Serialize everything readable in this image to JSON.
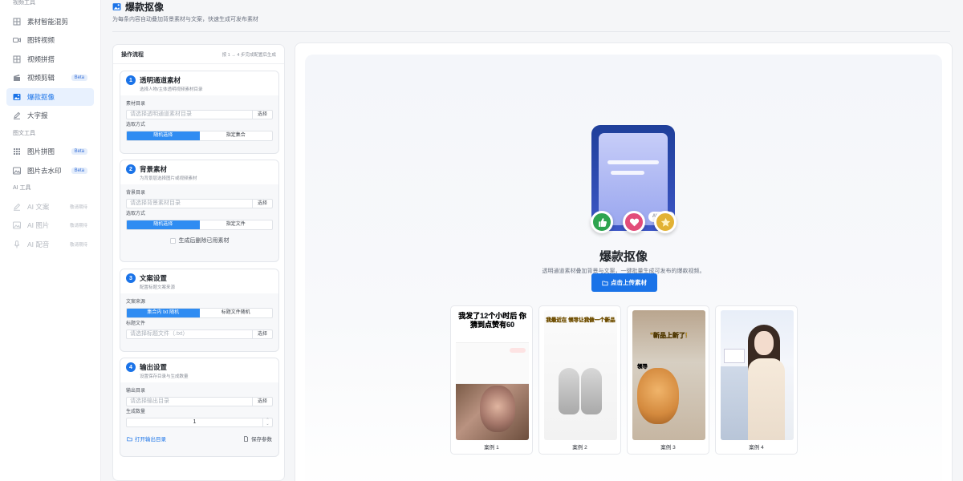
{
  "sidebar": {
    "sections": [
      {
        "title": "视频工具",
        "items": [
          {
            "label": "素材智能混剪",
            "icon": "grid-icon",
            "badge": "",
            "note": ""
          },
          {
            "label": "图转视频",
            "icon": "video-camera-icon",
            "badge": "",
            "note": ""
          },
          {
            "label": "视频拼搭",
            "icon": "grid-icon",
            "badge": "",
            "note": ""
          },
          {
            "label": "视频剪辑",
            "icon": "clapper-icon",
            "badge": "Beta",
            "note": ""
          },
          {
            "label": "爆款抠像",
            "icon": "image-icon",
            "badge": "",
            "note": "",
            "active": true
          },
          {
            "label": "大字报",
            "icon": "pen-icon",
            "badge": "",
            "note": ""
          }
        ]
      },
      {
        "title": "图文工具",
        "items": [
          {
            "label": "图片拼图",
            "icon": "grid-icon",
            "badge": "Beta",
            "note": ""
          },
          {
            "label": "图片去水印",
            "icon": "image-icon",
            "badge": "Beta",
            "note": ""
          }
        ]
      },
      {
        "title": "AI 工具",
        "items": [
          {
            "label": "AI 文案",
            "icon": "pen-icon",
            "badge": "",
            "note": "敬请期待"
          },
          {
            "label": "AI 图片",
            "icon": "image-icon",
            "badge": "",
            "note": "敬请期待"
          },
          {
            "label": "AI 配音",
            "icon": "microphone-icon",
            "badge": "",
            "note": "敬请期待"
          }
        ]
      }
    ]
  },
  "header": {
    "title": "爆款抠像",
    "subtitle": "为每条内容自动叠加背景素材与文案，快速生成可发布素材"
  },
  "flow": {
    "title": "操作流程",
    "hint": "按 1 → 4 步完成配置后生成",
    "step1": {
      "num": "1",
      "title": "透明通道素材",
      "desc": "选择人物/主体透明视频素材目录",
      "dir_label": "素材目录",
      "dir_placeholder": "请选择透明通道素材目录",
      "pick": "选择",
      "mode_label": "选取方式",
      "mode_a": "随机选择",
      "mode_b": "指定集合"
    },
    "step2": {
      "num": "2",
      "title": "背景素材",
      "desc": "为背景层选择图片或视频素材",
      "dir_label": "背景目录",
      "dir_placeholder": "请选择背景素材目录",
      "pick": "选择",
      "mode_label": "选取方式",
      "mode_a": "随机选择",
      "mode_b": "指定文件",
      "delete_after": "生成后删除已用素材"
    },
    "step3": {
      "num": "3",
      "title": "文案设置",
      "desc": "配置标题文案来源",
      "source_label": "文案来源",
      "source_a": "集合内 txt 随机",
      "source_b": "标题文件随机",
      "file_label": "标题文件",
      "file_placeholder": "请选择标题文件（.txt）",
      "pick": "选择"
    },
    "step4": {
      "num": "4",
      "title": "输出设置",
      "desc": "设置保存目录与生成数量",
      "out_label": "输出目录",
      "out_placeholder": "请选择输出目录",
      "pick": "选择",
      "count_label": "生成数量",
      "count": "1",
      "open_dir": "打开输出目录",
      "save_params": "保存参数"
    }
  },
  "hero": {
    "pill": "AI",
    "title": "爆款抠像",
    "desc": "透明通道素材叠加背景与文案，一键批量生成可发布的爆款视频。",
    "upload": "点击上传素材",
    "colors": {
      "like": "#2ea44f",
      "heart": "#e24c7a",
      "star": "#e2b234",
      "accent": "#1a73e8"
    }
  },
  "cases": [
    {
      "caption": "案例 1",
      "headline": "我发了12个小时后 你猜到点赞有60"
    },
    {
      "caption": "案例 2",
      "headline": "我最近在 领导让我做一个新品"
    },
    {
      "caption": "案例 3",
      "headline": "\"新品上新了!",
      "subline": "领导"
    },
    {
      "caption": "案例 4",
      "headline": ""
    }
  ]
}
